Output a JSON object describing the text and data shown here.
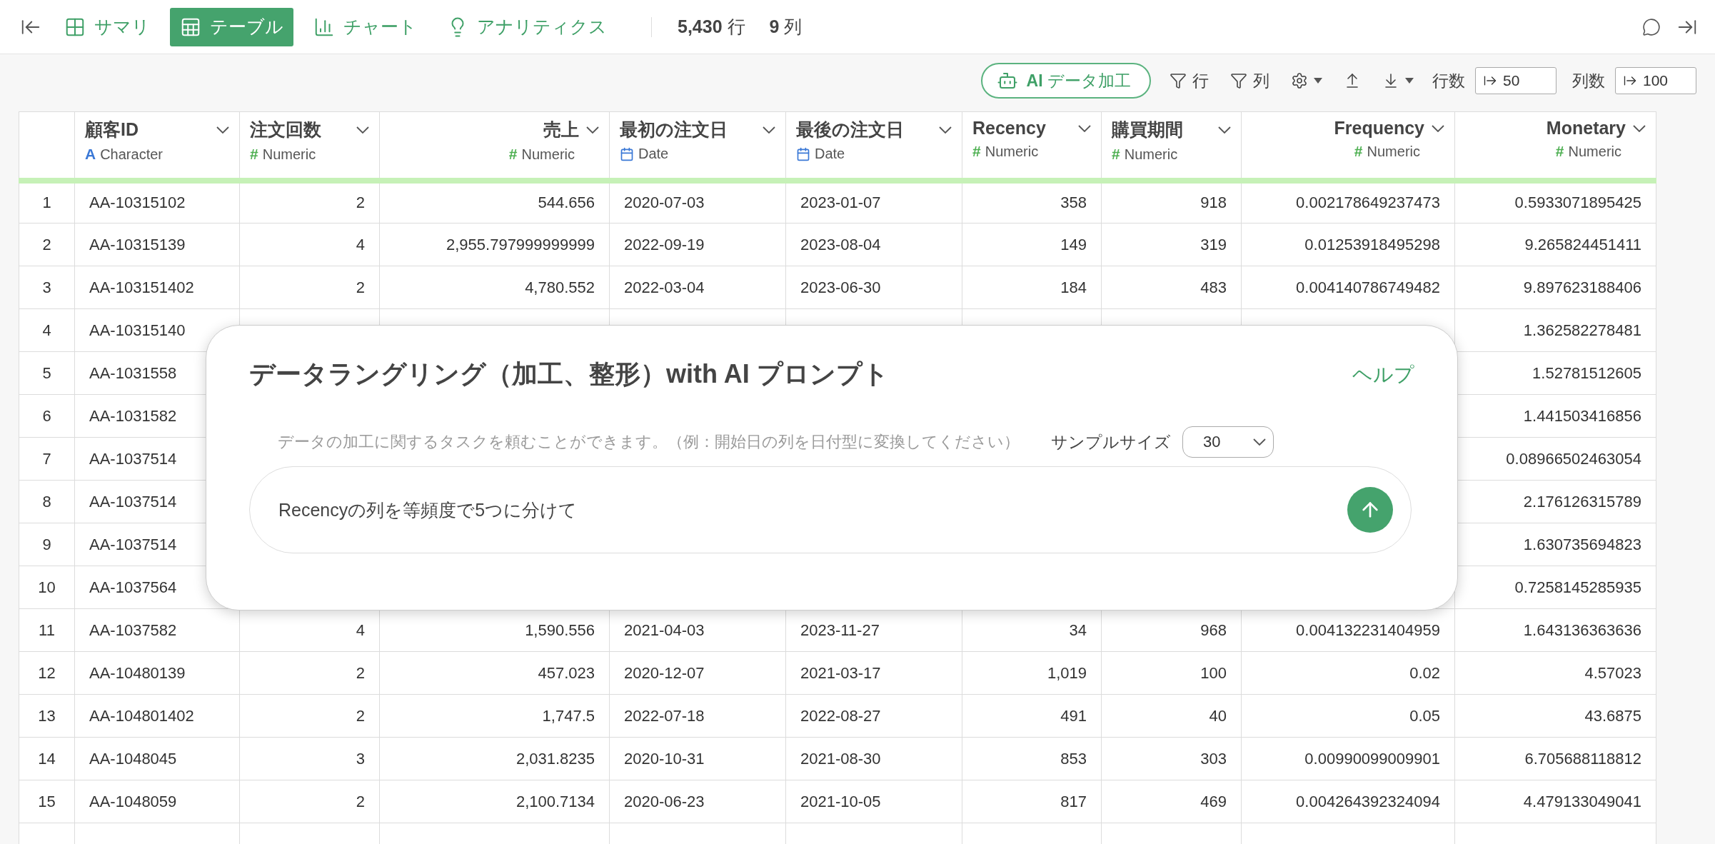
{
  "top_bar": {
    "tabs": [
      {
        "label": "サマリ",
        "kind": "summary",
        "selected": false
      },
      {
        "label": "テーブル",
        "kind": "table",
        "selected": true
      },
      {
        "label": "チャート",
        "kind": "chart",
        "selected": false
      },
      {
        "label": "アナリティクス",
        "kind": "analytics",
        "selected": false
      }
    ],
    "row_count": "**5,430** 行",
    "column_count": "**9** 列"
  },
  "toolbar": {
    "ai_button": "**AI** データ加工",
    "row_filter": "行",
    "column_filter": "列",
    "rows_label": "行数",
    "rows_value": "50",
    "columns_label": "列数",
    "columns_value": "100"
  },
  "table": {
    "columns": [
      {
        "name": "顧客ID",
        "type": "Character",
        "type_icon": "A",
        "kind": "character",
        "right_aligned": false
      },
      {
        "name": "注文回数",
        "type": "Numeric",
        "type_icon": "#",
        "kind": "numeric",
        "right_aligned": false
      },
      {
        "name": "売上",
        "type": "Numeric",
        "type_icon": "#",
        "kind": "numeric",
        "right_aligned": true
      },
      {
        "name": "最初の注文日",
        "type": "Date",
        "kind": "date",
        "right_aligned": false
      },
      {
        "name": "最後の注文日",
        "type": "Date",
        "kind": "date",
        "right_aligned": false
      },
      {
        "name": "Recency",
        "type": "Numeric",
        "type_icon": "#",
        "kind": "numeric",
        "right_aligned": false
      },
      {
        "name": "購買期間",
        "type": "Numeric",
        "type_icon": "#",
        "kind": "numeric",
        "right_aligned": false
      },
      {
        "name": "Frequency",
        "type": "Numeric",
        "type_icon": "#",
        "kind": "numeric",
        "right_aligned": true
      },
      {
        "name": "Monetary",
        "type": "Numeric",
        "type_icon": "#",
        "kind": "numeric",
        "right_aligned": true
      }
    ],
    "rows": [
      {
        "number": "1",
        "cells": [
          "AA-10315102",
          "2",
          "544.656",
          "2020-07-03",
          "2023-01-07",
          "358",
          "918",
          "0.002178649237473",
          "0.5933071895425"
        ]
      },
      {
        "number": "2",
        "cells": [
          "AA-10315139",
          "4",
          "2,955.797999999999",
          "2022-09-19",
          "2023-08-04",
          "149",
          "319",
          "0.01253918495298",
          "9.265824451411"
        ]
      },
      {
        "number": "3",
        "cells": [
          "AA-103151402",
          "2",
          "4,780.552",
          "2022-03-04",
          "2023-06-30",
          "184",
          "483",
          "0.004140786749482",
          "9.897623188406"
        ]
      },
      {
        "number": "4",
        "cells": [
          "AA-10315140",
          null,
          null,
          null,
          null,
          null,
          null,
          null,
          "1.362582278481"
        ]
      },
      {
        "number": "5",
        "cells": [
          "AA-1031558",
          null,
          null,
          null,
          null,
          null,
          null,
          null,
          "1.52781512605"
        ]
      },
      {
        "number": "6",
        "cells": [
          "AA-1031582",
          null,
          null,
          null,
          null,
          null,
          null,
          null,
          "1.441503416856"
        ]
      },
      {
        "number": "7",
        "cells": [
          "AA-1037514",
          null,
          null,
          null,
          null,
          null,
          null,
          null,
          "0.08966502463054"
        ]
      },
      {
        "number": "8",
        "cells": [
          "AA-1037514",
          null,
          null,
          null,
          null,
          null,
          null,
          null,
          "2.176126315789"
        ]
      },
      {
        "number": "9",
        "cells": [
          "AA-1037514",
          null,
          null,
          null,
          null,
          null,
          null,
          null,
          "1.630735694823"
        ]
      },
      {
        "number": "10",
        "cells": [
          "AA-1037564",
          null,
          null,
          null,
          null,
          null,
          null,
          null,
          "0.7258145285935"
        ]
      },
      {
        "number": "11",
        "cells": [
          "AA-1037582",
          "4",
          "1,590.556",
          "2021-04-03",
          "2023-11-27",
          "34",
          "968",
          "0.004132231404959",
          "1.643136363636"
        ]
      },
      {
        "number": "12",
        "cells": [
          "AA-10480139",
          "2",
          "457.023",
          "2020-12-07",
          "2021-03-17",
          "1,019",
          "100",
          "0.02",
          "4.57023"
        ]
      },
      {
        "number": "13",
        "cells": [
          "AA-104801402",
          "2",
          "1,747.5",
          "2022-07-18",
          "2022-08-27",
          "491",
          "40",
          "0.05",
          "43.6875"
        ]
      },
      {
        "number": "14",
        "cells": [
          "AA-1048045",
          "3",
          "2,031.8235",
          "2020-10-31",
          "2021-08-30",
          "853",
          "303",
          "0.00990099009901",
          "6.705688118812"
        ]
      },
      {
        "number": "15",
        "cells": [
          "AA-1048059",
          "2",
          "2,100.7134",
          "2020-06-23",
          "2021-10-05",
          "817",
          "469",
          "0.004264392324094",
          "4.479133049041"
        ]
      }
    ]
  },
  "dialog": {
    "title": "データラングリング（加工、整形）with AI プロンプト",
    "help_link": "ヘルプ",
    "hint": "データの加工に関するタスクを頼むことができます。（例：開始日の列を日付型に変換してください）",
    "sample_size_label": "サンプルサイズ",
    "sample_size": "30",
    "prompt": "Recencyの列を等頻度で5つに分けて"
  }
}
